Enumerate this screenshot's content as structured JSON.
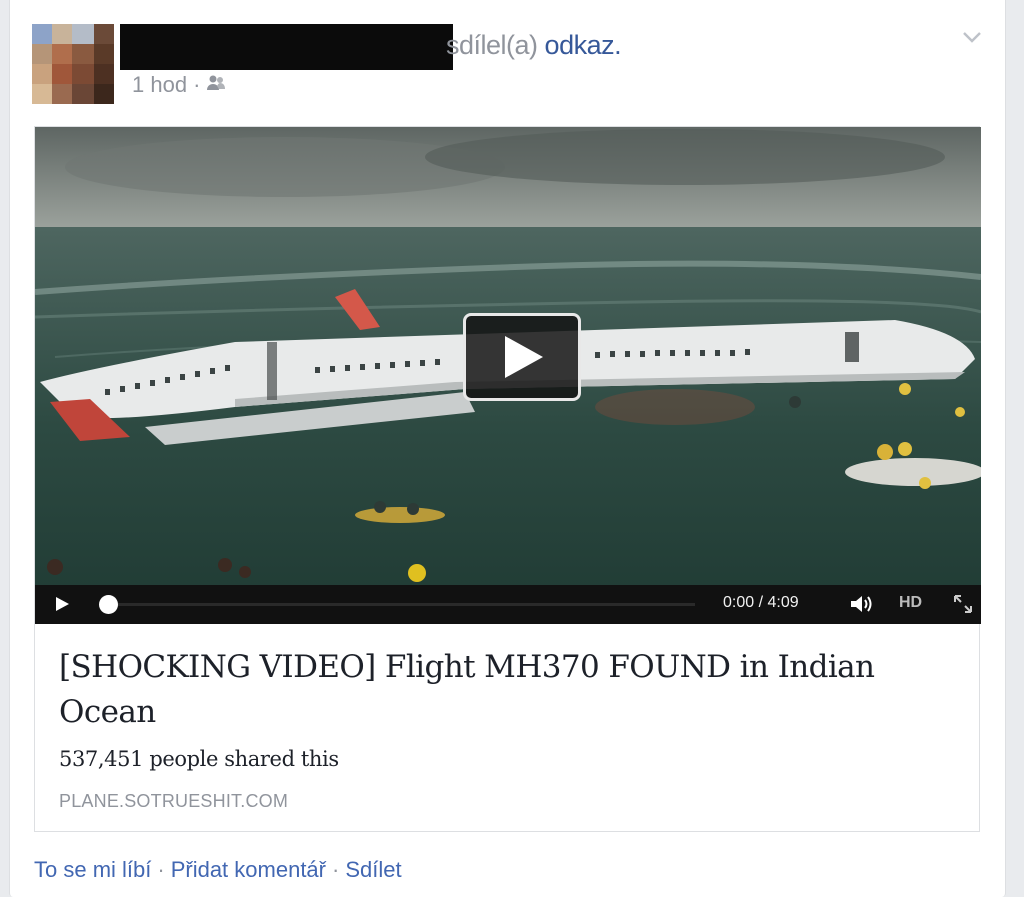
{
  "post": {
    "action_text": "sdílel(a)",
    "action_link": "odkaz",
    "action_period": ".",
    "time": "1 hod",
    "separator": "·",
    "audience_icon": "friends-icon",
    "menu_icon": "chevron-down-icon"
  },
  "video": {
    "current_time": "0:00",
    "duration": "4:09",
    "time_display": "0:00 / 4:09",
    "quality_label": "HD",
    "progress": 0
  },
  "link": {
    "title": "[SHOCKING VIDEO] Flight MH370 FOUND in Indian Ocean",
    "shares": "537,451 people shared this",
    "domain": "PLANE.SOTRUESHIT.COM"
  },
  "actions": {
    "like": "To se mi líbí",
    "comment": "Přidat komentář",
    "share": "Sdílet",
    "separator": "·"
  },
  "colors": {
    "link": "#365899",
    "action": "#4267b2",
    "meta": "#90949c"
  }
}
